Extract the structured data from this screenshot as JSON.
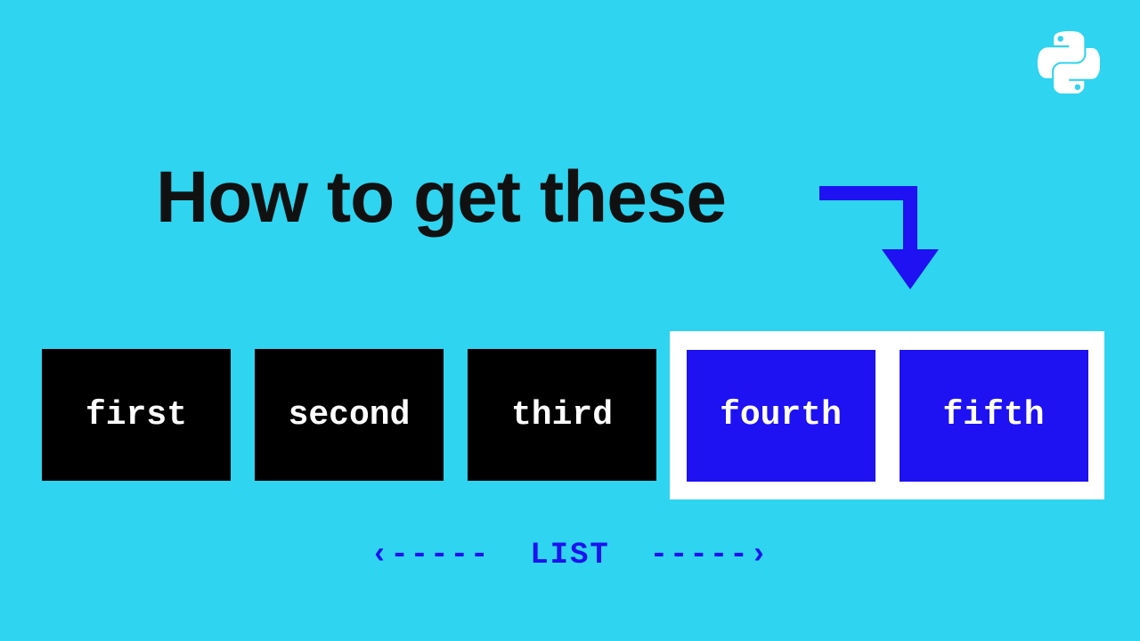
{
  "title": "How to get these",
  "label": "LIST",
  "items": [
    "first",
    "second",
    "third",
    "fourth",
    "fifth"
  ],
  "arrow_deco_left": "‹-----",
  "arrow_deco_right": "-----›"
}
